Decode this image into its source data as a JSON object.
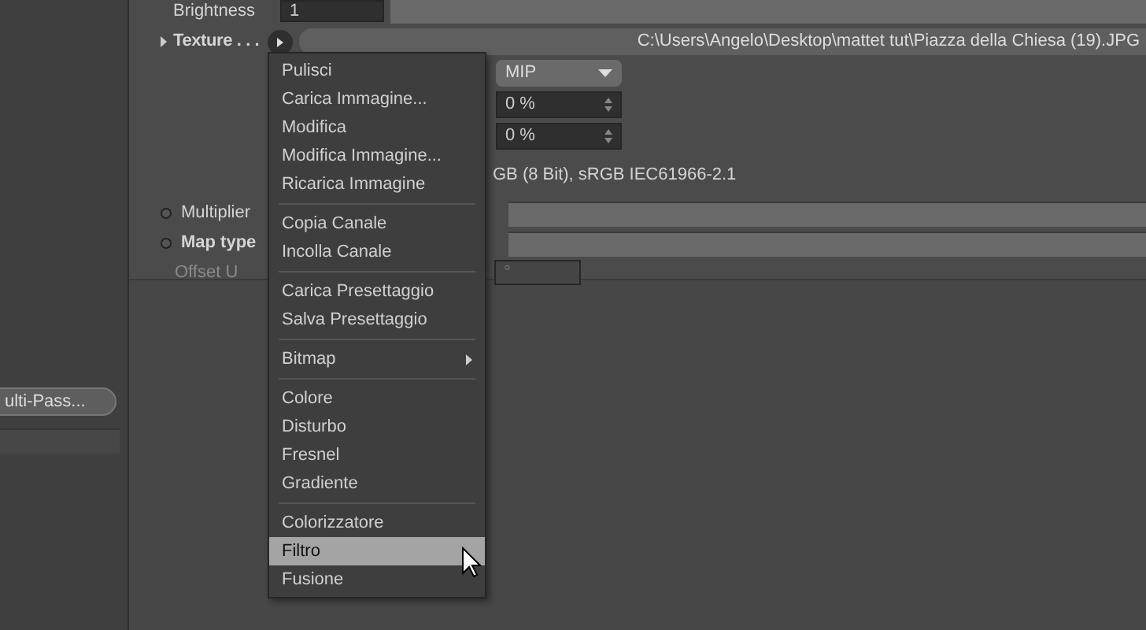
{
  "left_panel": {
    "button": "ulti-Pass..."
  },
  "attributes": {
    "brightness": {
      "label": "Brightness",
      "value": "1"
    },
    "texture": {
      "label": "Texture . . .",
      "path": "C:\\Users\\Angelo\\Desktop\\mattet tut\\Piazza della Chiesa (19).JPG"
    },
    "sampling": "MIP",
    "field_1": "0 %",
    "field_2": "0 %",
    "color_profile": "GB (8 Bit), sRGB IEC61966-2.1",
    "multiplier": {
      "label": "Multiplier"
    },
    "map_type": {
      "label": "Map type"
    },
    "offset_u": {
      "label": "Offset U",
      "value": "°",
      "disabled": true
    }
  },
  "context_menu": {
    "groups": [
      [
        {
          "label": "Pulisci",
          "selected": false
        },
        {
          "label": "Carica Immagine...",
          "selected": false
        },
        {
          "label": "Modifica",
          "selected": false
        },
        {
          "label": "Modifica Immagine...",
          "selected": false
        },
        {
          "label": "Ricarica Immagine",
          "selected": false
        }
      ],
      [
        {
          "label": "Copia Canale",
          "selected": false
        },
        {
          "label": "Incolla Canale",
          "selected": false
        }
      ],
      [
        {
          "label": "Carica Presettaggio",
          "selected": false
        },
        {
          "label": "Salva Presettaggio",
          "selected": false
        }
      ],
      [
        {
          "label": "Bitmap",
          "selected": false,
          "kind": "submenu"
        }
      ],
      [
        {
          "label": "Colore",
          "selected": false
        },
        {
          "label": "Disturbo",
          "selected": false
        },
        {
          "label": "Fresnel",
          "selected": false
        },
        {
          "label": "Gradiente",
          "selected": false
        }
      ],
      [
        {
          "label": "Colorizzatore",
          "selected": false
        },
        {
          "label": "Filtro",
          "selected": true
        },
        {
          "label": "Fusione",
          "selected": false
        }
      ]
    ]
  }
}
